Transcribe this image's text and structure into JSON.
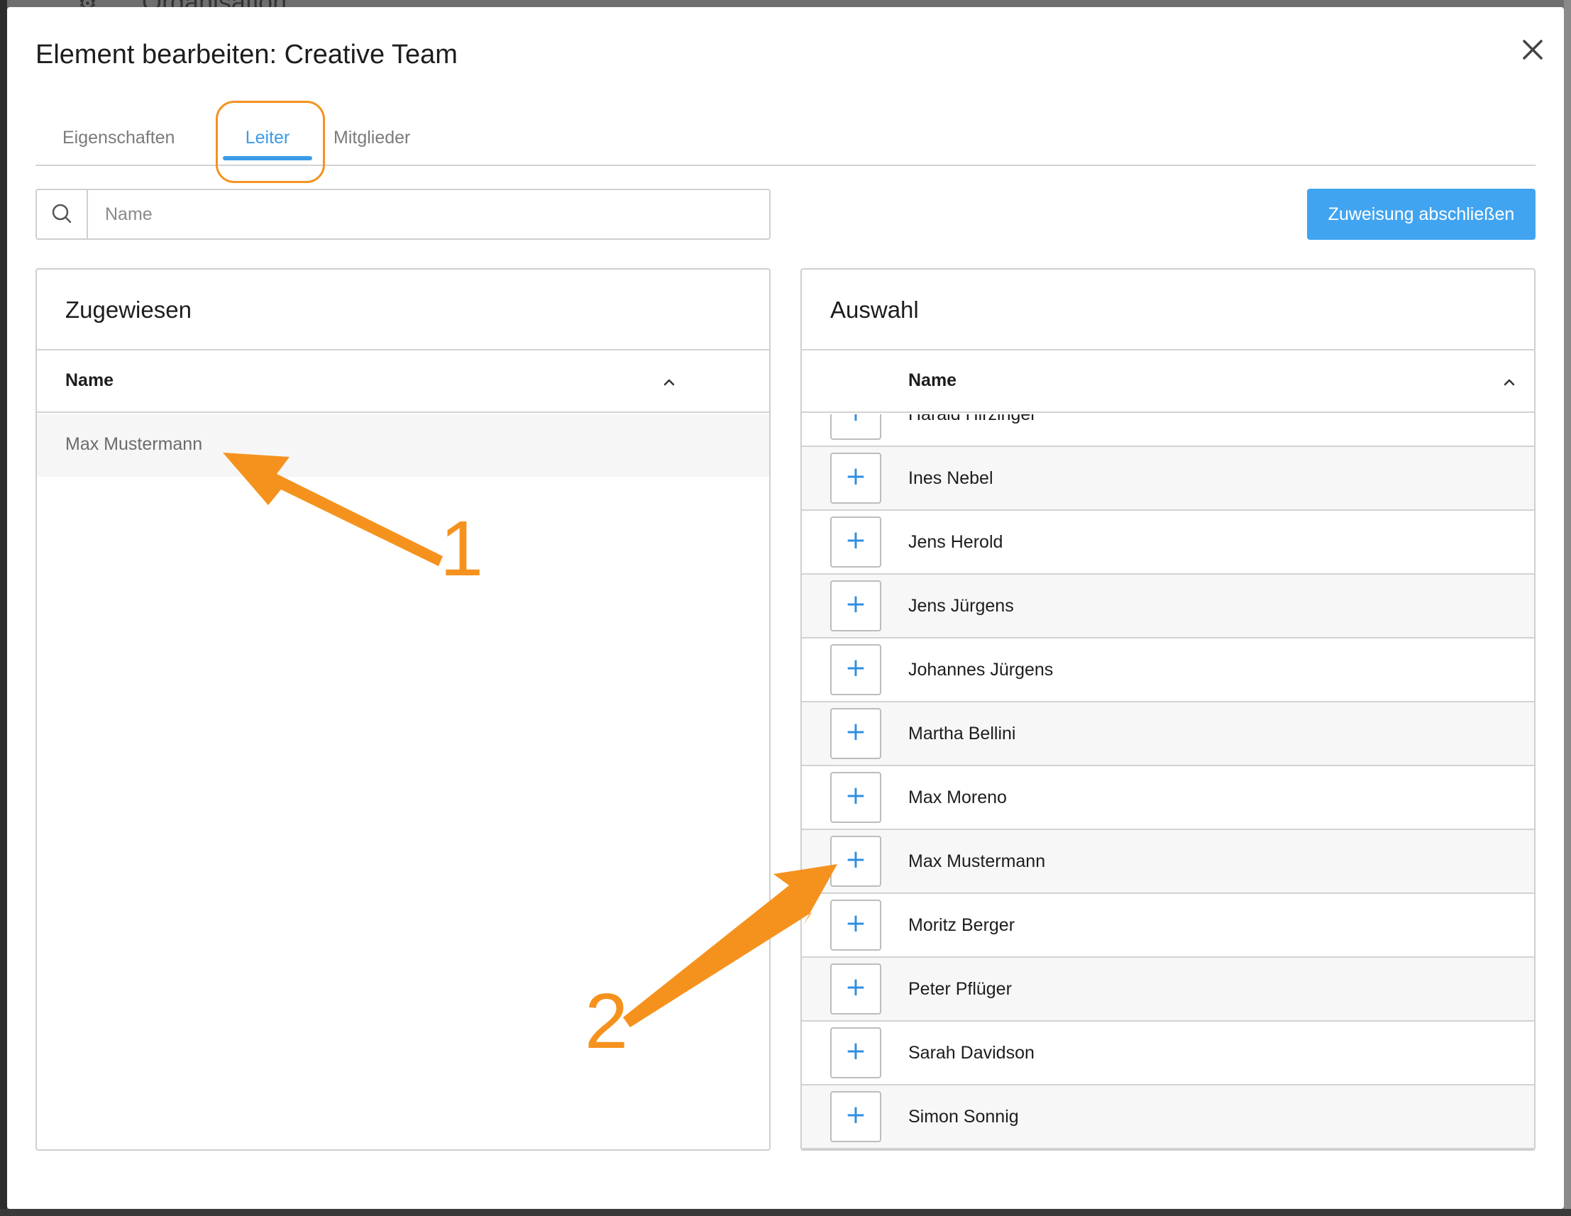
{
  "background": {
    "page_title": "Organisation"
  },
  "dialog": {
    "title": "Element bearbeiten: Creative Team",
    "close_icon": "close-icon"
  },
  "tabs": [
    {
      "label": "Eigenschaften",
      "active": false
    },
    {
      "label": "Leiter",
      "active": true
    },
    {
      "label": "Mitglieder",
      "active": false
    }
  ],
  "search": {
    "placeholder": "Name",
    "value": ""
  },
  "actions": {
    "finish_label": "Zuweisung abschließen"
  },
  "assigned_panel": {
    "title": "Zugewiesen",
    "column_header": "Name",
    "rows": [
      "Max Mustermann"
    ]
  },
  "selection_panel": {
    "title": "Auswahl",
    "column_header": "Name",
    "rows": [
      "Harald Hirzinger",
      "Ines Nebel",
      "Jens Herold",
      "Jens Jürgens",
      "Johannes Jürgens",
      "Martha Bellini",
      "Max Moreno",
      "Max Mustermann",
      "Moritz Berger",
      "Peter Pflüger",
      "Sarah Davidson",
      "Simon Sonnig"
    ],
    "add_button_symbol": "+"
  },
  "annotations": {
    "label_1": "1",
    "label_2": "2",
    "color": "#f5921e"
  },
  "colors": {
    "accent": "#3a9be8",
    "primary_button": "#41a4f1",
    "highlight": "#f5921e"
  }
}
